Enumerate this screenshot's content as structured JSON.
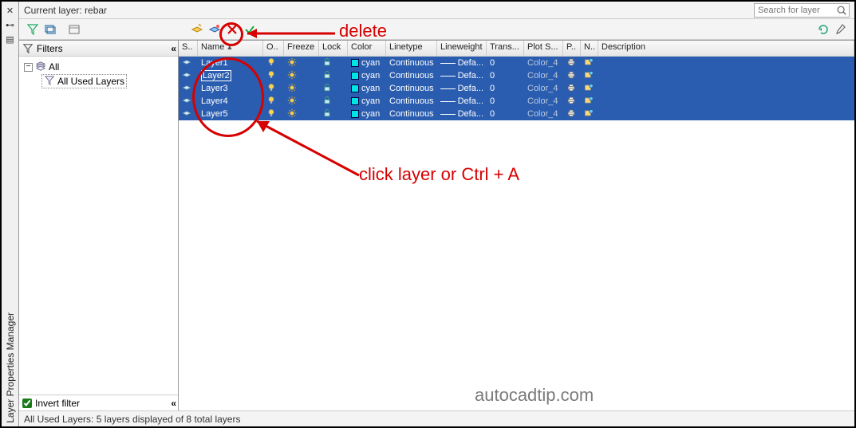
{
  "window_title": "Layer Properties Manager",
  "current_layer_label": "Current layer: rebar",
  "search_placeholder": "Search for layer",
  "filters": {
    "title": "Filters",
    "root": "All",
    "child": "All Used Layers",
    "invert_label": "Invert filter",
    "invert_checked": true
  },
  "columns": {
    "status": "S..",
    "name": "Name",
    "on": "O..",
    "freeze": "Freeze",
    "lock": "Lock",
    "color": "Color",
    "linetype": "Linetype",
    "lineweight": "Lineweight",
    "trans": "Trans...",
    "plots": "Plot S...",
    "p": "P..",
    "n": "N..",
    "desc": "Description"
  },
  "layers": [
    {
      "name": "Layer1",
      "color": "cyan",
      "linetype": "Continuous",
      "lineweight": "Defa...",
      "trans": "0",
      "plotstyle": "Color_4"
    },
    {
      "name": "Layer2",
      "color": "cyan",
      "linetype": "Continuous",
      "lineweight": "Defa...",
      "trans": "0",
      "plotstyle": "Color_4"
    },
    {
      "name": "Layer3",
      "color": "cyan",
      "linetype": "Continuous",
      "lineweight": "Defa...",
      "trans": "0",
      "plotstyle": "Color_4"
    },
    {
      "name": "Layer4",
      "color": "cyan",
      "linetype": "Continuous",
      "lineweight": "Defa...",
      "trans": "0",
      "plotstyle": "Color_4"
    },
    {
      "name": "Layer5",
      "color": "cyan",
      "linetype": "Continuous",
      "lineweight": "Defa...",
      "trans": "0",
      "plotstyle": "Color_4"
    }
  ],
  "status_text": "All Used Layers: 5 layers displayed of 8 total layers",
  "annotations": {
    "delete": "delete",
    "click_hint": "click layer or Ctrl + A",
    "watermark": "autocadtip.com"
  }
}
